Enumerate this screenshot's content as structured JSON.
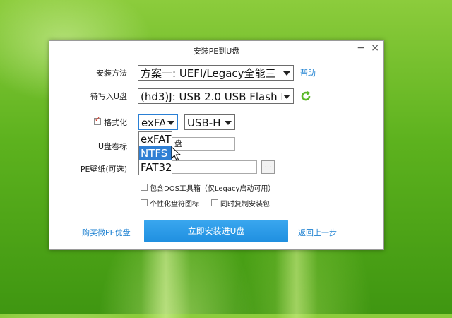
{
  "window": {
    "title": "安装PE到U盘",
    "minimize_glyph": "−",
    "close_glyph": "×"
  },
  "form": {
    "install_method_label": "安装方法",
    "install_method_value": "方案一: UEFI/Legacy全能三",
    "help_link": "帮助",
    "target_disk_label": "待写入U盘",
    "target_disk_value": "(hd3)J: USB 2.0 USB Flash D",
    "format_label": "格式化",
    "format_checked": true,
    "filesystem_value": "exFA",
    "boot_mode_value": "USB-H",
    "volume_label": "U盘卷标",
    "volume_value": "盘",
    "wallpaper_label": "PE壁纸(可选)",
    "wallpaper_value": "",
    "browse_label": "...",
    "options": [
      {
        "label": "包含DOS工具箱（仅Legacy启动可用）",
        "checked": false
      },
      {
        "label": "个性化盘符图标",
        "checked": false
      },
      {
        "label": "同时复制安装包",
        "checked": false
      }
    ]
  },
  "filesystem_dropdown": {
    "items": [
      "exFAT",
      "NTFS",
      "FAT32"
    ],
    "highlighted": "NTFS"
  },
  "footer": {
    "buy_link": "购买微PE优盘",
    "install_button": "立即安装进U盘",
    "back_link": "返回上一步"
  },
  "icons": {
    "refresh": "refresh-icon",
    "cursor": "mouse-cursor-icon"
  },
  "colors": {
    "accent": "#1f8fe0",
    "link": "#1a7fd0",
    "highlight": "#2f7fd4",
    "refresh": "#5cb82a"
  }
}
